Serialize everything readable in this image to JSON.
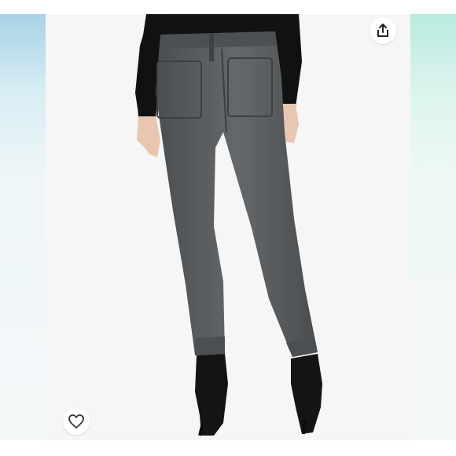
{
  "listing": {
    "photo_subject": "",
    "colors": {
      "pants": "#5a5d5f",
      "top": "#111111",
      "boots": "#151515",
      "background": "#f6f6f6",
      "accent_left": "#a8d2e6",
      "accent_right": "#b8eadf"
    }
  },
  "actions": {
    "share_icon": "share-icon",
    "like_icon": "heart-icon"
  }
}
